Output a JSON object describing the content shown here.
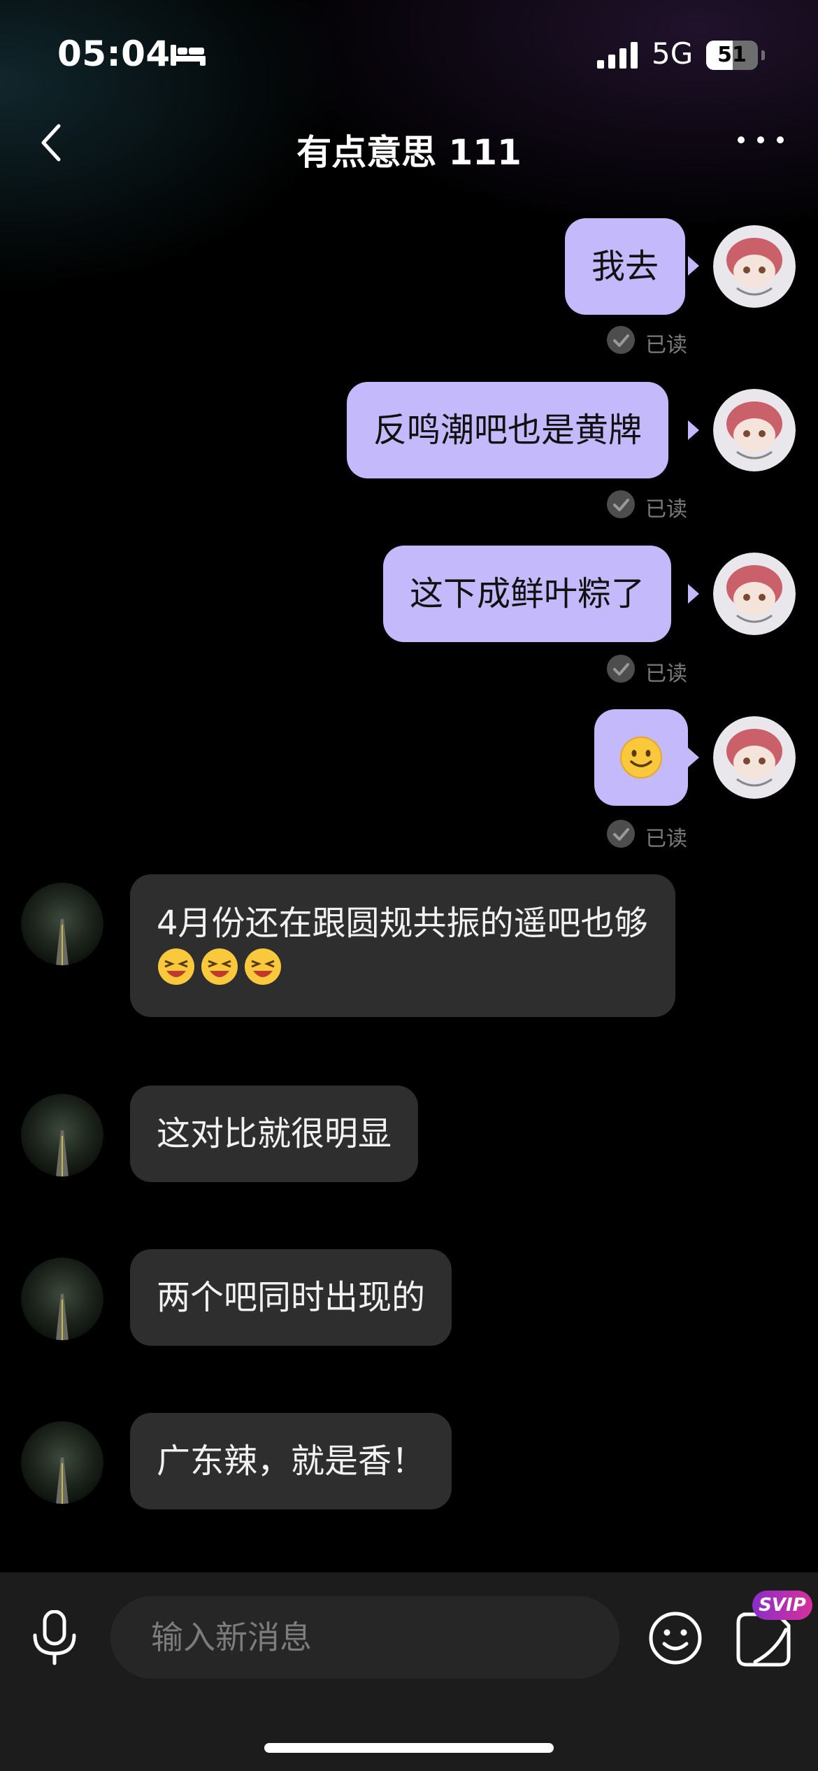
{
  "status_bar": {
    "time": "05:04",
    "network": "5G",
    "battery_level": "51",
    "battery_fraction": 0.51
  },
  "header": {
    "title": "有点意思 111"
  },
  "messages": [
    {
      "direction": "out",
      "text": "我去",
      "status": "已读"
    },
    {
      "direction": "out",
      "text": "反鸣潮吧也是黄牌",
      "status": "已读"
    },
    {
      "direction": "out",
      "text": "这下成鲜叶粽了",
      "status": "已读"
    },
    {
      "direction": "out",
      "emoji": "smile-emoji",
      "status": "已读"
    },
    {
      "direction": "in",
      "text": "4月份还在跟圆规共振的遥吧也够",
      "emoji": "laughing-emoji",
      "emoji_count": 3
    },
    {
      "direction": "in",
      "text": "这对比就很明显"
    },
    {
      "direction": "in",
      "text": "两个吧同时出现的"
    },
    {
      "direction": "in",
      "text": "广东辣，就是香！"
    }
  ],
  "input_bar": {
    "placeholder": "输入新消息",
    "badge": "SVIP"
  },
  "colors": {
    "outgoing_bubble": "#c4b9fb",
    "incoming_bubble": "#2e2e2e",
    "background": "#000000",
    "input_bar": "#1c1c1c"
  }
}
